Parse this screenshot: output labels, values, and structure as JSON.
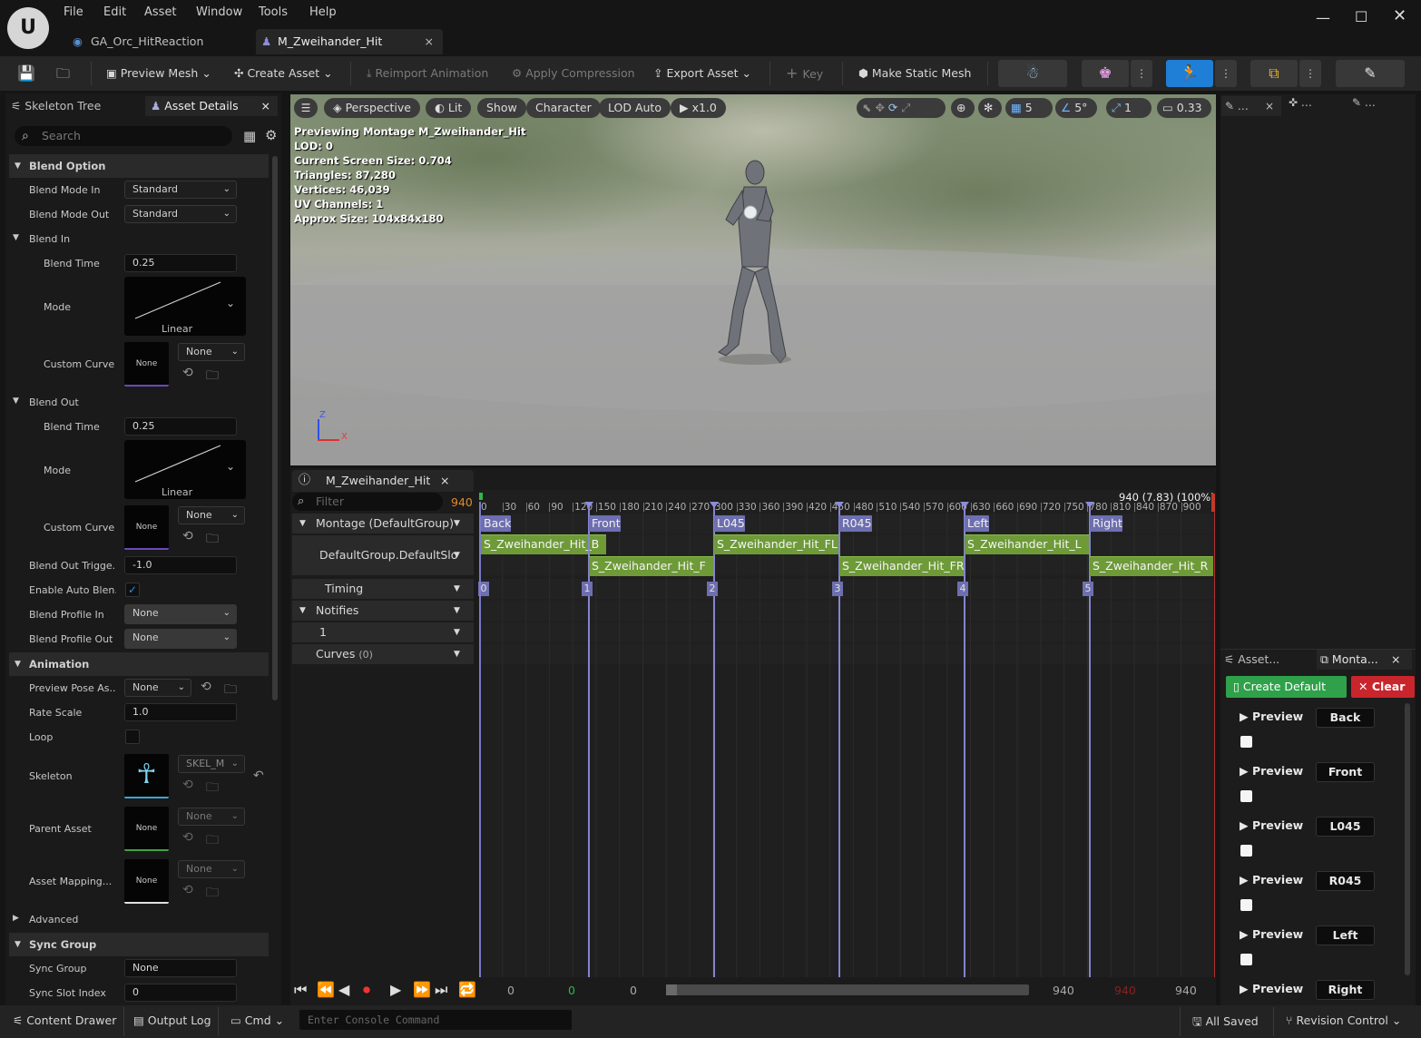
{
  "menu": [
    "File",
    "Edit",
    "Asset",
    "Window",
    "Tools",
    "Help"
  ],
  "doc_tabs": [
    "GA_Orc_HitReaction",
    "M_Zweihander_Hit"
  ],
  "toolbar": {
    "preview_mesh": "Preview Mesh",
    "create_asset": "Create Asset",
    "reimport": "Reimport Animation",
    "apply_compression": "Apply Compression",
    "export_asset": "Export Asset",
    "key": "Key",
    "make_static_mesh": "Make Static Mesh"
  },
  "left": {
    "tab1": "Skeleton Tree",
    "tab2": "Asset Details",
    "search_placeholder": "Search",
    "cat_blend_option": "Blend Option",
    "blend_mode_in": "Blend Mode In",
    "blend_mode_in_val": "Standard",
    "blend_mode_out": "Blend Mode Out",
    "blend_mode_out_val": "Standard",
    "cat_blend_in": "Blend In",
    "blend_time": "Blend Time",
    "blend_in_time": "0.25",
    "mode": "Mode",
    "linear": "Linear",
    "custom_curve": "Custom Curve",
    "none": "None",
    "cat_blend_out": "Blend Out",
    "blend_out_time": "0.25",
    "blend_out_trigger": "Blend Out Trigge...",
    "blend_out_trigger_val": "-1.0",
    "enable_auto_blend": "Enable Auto Blen...",
    "blend_profile_in": "Blend Profile In",
    "blend_profile_out": "Blend Profile Out",
    "cat_animation": "Animation",
    "preview_pose": "Preview Pose As...",
    "rate_scale": "Rate Scale",
    "rate_scale_val": "1.0",
    "loop": "Loop",
    "skeleton": "Skeleton",
    "skeleton_val": "SKEL_M",
    "parent_asset": "Parent Asset",
    "asset_mapping": "Asset Mapping...",
    "advanced": "Advanced",
    "cat_sync_group": "Sync Group",
    "sync_group": "Sync Group",
    "sync_group_val": "None",
    "sync_slot_index": "Sync Slot Index",
    "sync_slot_index_val": "0"
  },
  "viewport": {
    "perspective": "Perspective",
    "lit": "Lit",
    "show": "Show",
    "character": "Character",
    "lod": "LOD Auto",
    "speed": "x1.0",
    "grid_val": "5",
    "angle_val": "5°",
    "scale_val": "1",
    "cam_speed": "0.33",
    "info": [
      "Previewing Montage M_Zweihander_Hit",
      "LOD: 0",
      "Current Screen Size: 0.704",
      "Triangles: 87,280",
      "Vertices: 46,039",
      "UV Channels: 1",
      "Approx Size: 104x84x180"
    ],
    "axis_z": "Z",
    "axis_x": "X"
  },
  "montage": {
    "tab": "M_Zweihander_Hit",
    "filter_placeholder": "Filter",
    "frame": "940",
    "frame_info": "940 (7.83) (100%)",
    "tracks": {
      "montage": "Montage (DefaultGroup)",
      "slot": "DefaultGroup.DefaultSlo",
      "timing": "Timing",
      "notifies": "Notifies",
      "notify_track": "1",
      "curves": "Curves",
      "curves_count": "(0)"
    },
    "ticks": [
      "0",
      "30",
      "60",
      "90",
      "120",
      "150",
      "180",
      "210",
      "240",
      "270",
      "300",
      "330",
      "360",
      "390",
      "420",
      "450",
      "480",
      "510",
      "540",
      "570",
      "600",
      "630",
      "660",
      "690",
      "720",
      "750",
      "780",
      "810",
      "840",
      "870",
      "900"
    ],
    "sections": [
      "Back",
      "Front",
      "L045",
      "R045",
      "Left",
      "Right"
    ],
    "segments_top": [
      "S_Zweihander_Hit_B",
      "S_Zweihander_Hit_FL",
      "S_Zweihander_Hit_L"
    ],
    "segments_bottom": [
      "S_Zweihander_Hit_F",
      "S_Zweihander_Hit_FR",
      "S_Zweihander_Hit_R"
    ],
    "branch_markers": [
      "0",
      "1",
      "2",
      "3",
      "4",
      "5"
    ],
    "bottom_nums": [
      "0",
      "0",
      "0",
      "940",
      "940",
      "940"
    ]
  },
  "right": {
    "tab_asset": "Asset...",
    "tab_montage": "Monta...",
    "create_default": "Create Default",
    "clear": "Clear",
    "preview": "Preview",
    "sections": [
      "Back",
      "Front",
      "L045",
      "R045",
      "Left",
      "Right"
    ]
  },
  "status": {
    "content_drawer": "Content Drawer",
    "output_log": "Output Log",
    "cmd": "Cmd",
    "console_placeholder": "Enter Console Command",
    "all_saved": "All Saved",
    "revision_control": "Revision Control"
  },
  "colors": {
    "accent_blue": "#1f7ed6",
    "section_purple": "#6e6fb0",
    "segment_green": "#6e9a38",
    "create_green": "#2fa14a",
    "clear_red": "#c9252c",
    "frame_orange": "#e0892b"
  }
}
